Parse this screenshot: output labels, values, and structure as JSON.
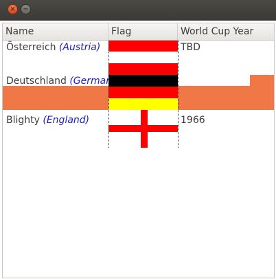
{
  "window": {
    "close_glyph": "×",
    "minimize_glyph": "−"
  },
  "columns": {
    "name": "Name",
    "flag": "Flag",
    "year": "World Cup Year"
  },
  "rows": [
    {
      "name_native": "Österreich",
      "name_english": "(Austria)",
      "year": "TBD",
      "flag_colors": [
        "#ff0000",
        "#ffffff",
        "#ff0000"
      ]
    },
    {
      "name_native": "Deutschland",
      "name_english": "(Germany)",
      "year": "",
      "selected": true,
      "flag_colors": [
        "#000000",
        "#ff0000",
        "#ffff00"
      ]
    },
    {
      "name_native": "Blighty",
      "name_english": "(England)",
      "year": "1966",
      "flag_colors": [
        "#ffffff",
        "#ff0000"
      ]
    }
  ],
  "colors": {
    "selection": "#f07746",
    "english_name": "#1d1dbf"
  }
}
